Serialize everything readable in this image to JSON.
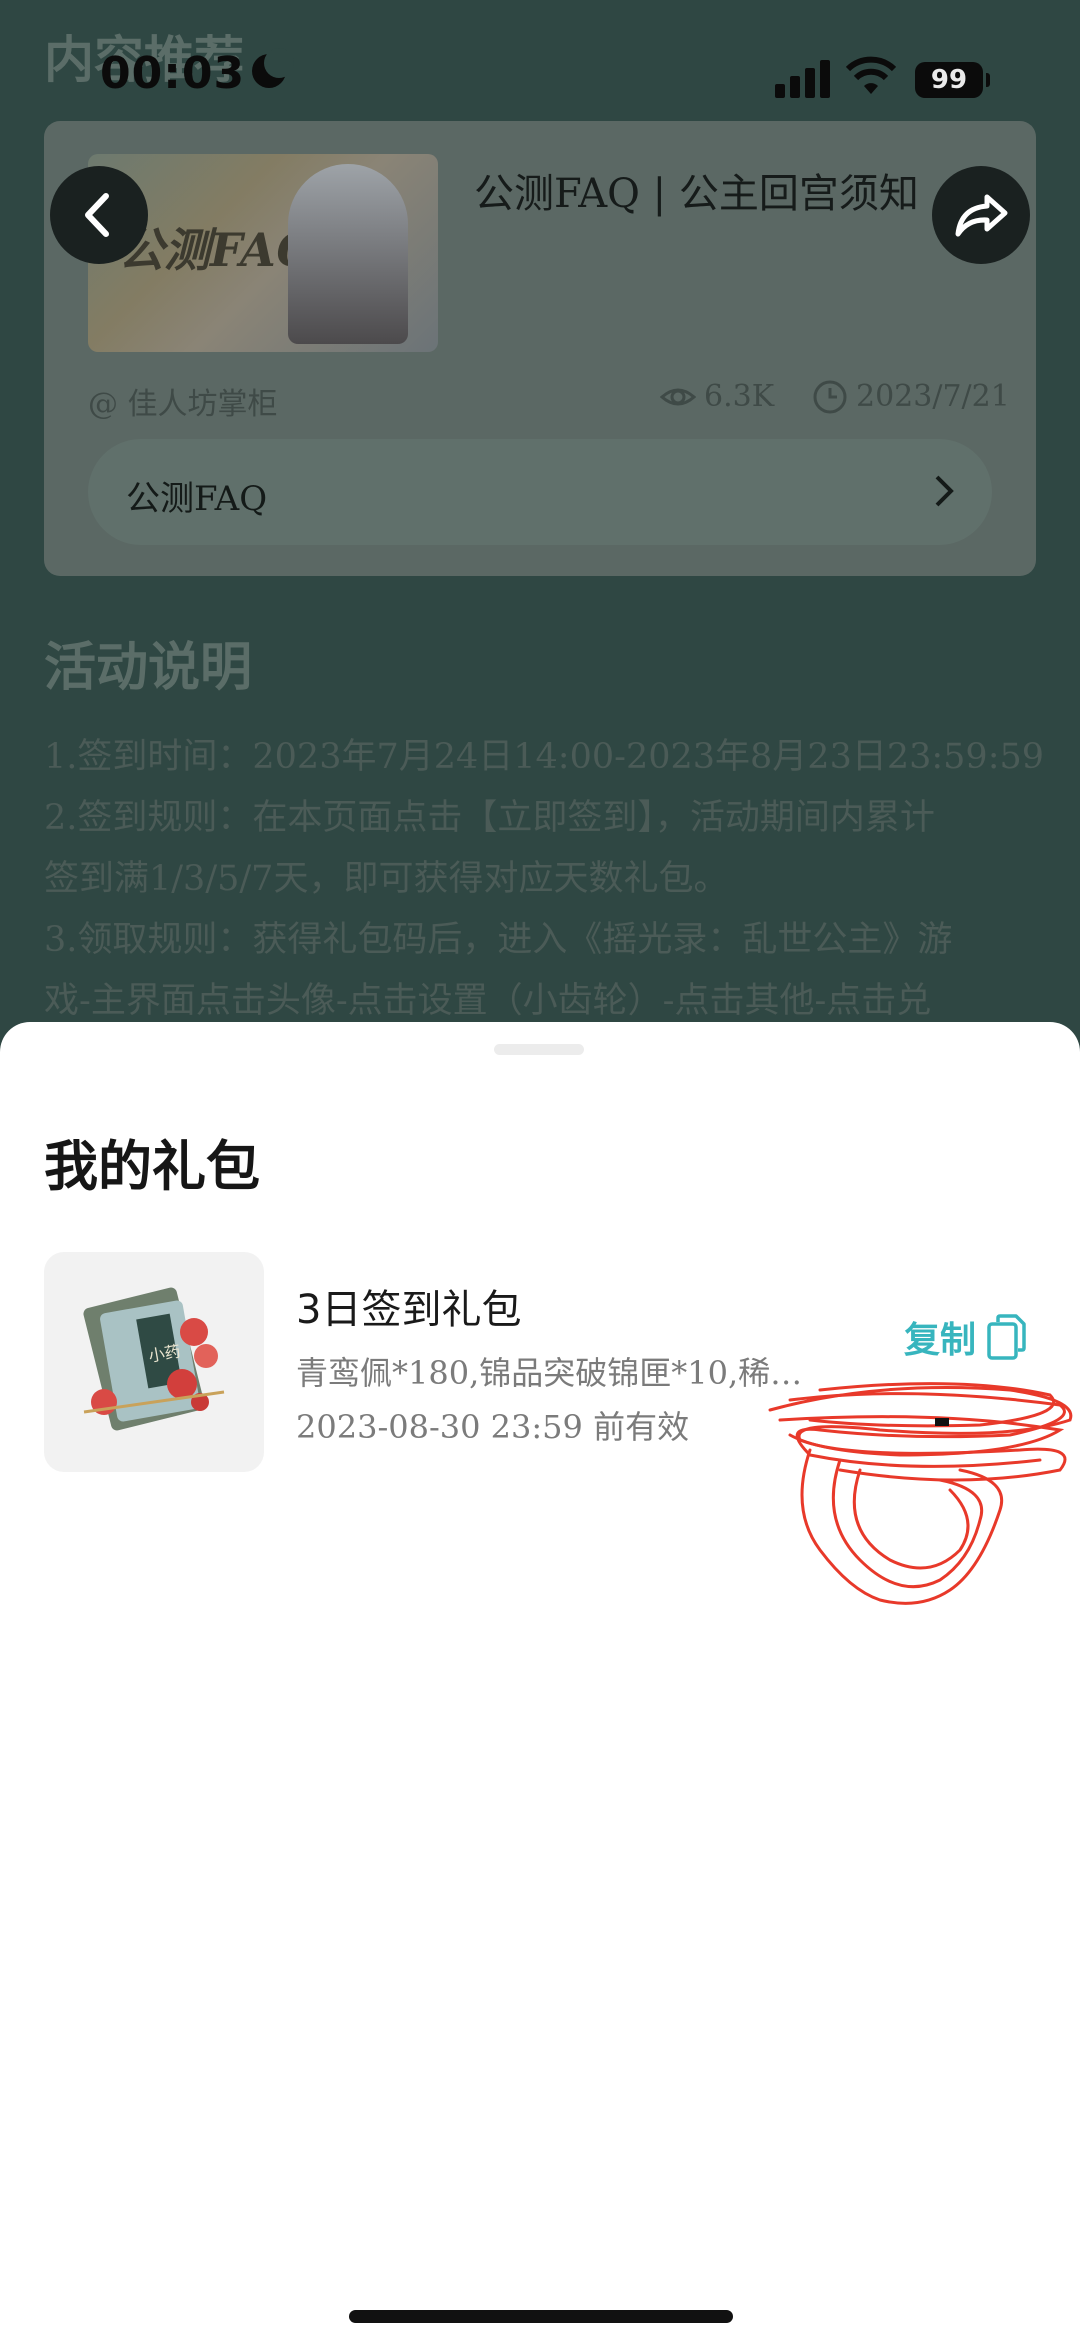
{
  "status_bar": {
    "time": "00:03",
    "battery": "99"
  },
  "background": {
    "section_title": "内容推荐",
    "card": {
      "title": "公测FAQ | 公主回宫须知",
      "thumbnail_label": "公测FAQ",
      "author": "@ 佳人坊掌柜",
      "views": "6.3K",
      "date": "2023/7/21",
      "link_label": "公测FAQ"
    },
    "description": {
      "title": "活动说明",
      "lines": [
        "1.签到时间：2023年7月24日14:00-2023年8月23日23:59:59",
        "2.签到规则：在本页面点击【立即签到】，活动期间内累计",
        "签到满1/3/5/7天，即可获得对应天数礼包。",
        "3.领取规则：获得礼包码后，进入《摇光录：乱世公主》游",
        "戏-主界面点击头像-点击设置（小齿轮）-点击其他-点击兑"
      ]
    }
  },
  "sheet": {
    "title": "我的礼包",
    "gifts": [
      {
        "name": "3日签到礼包",
        "items": "青鸾佩*180,锦品突破锦匣*10,稀…",
        "expiry": "2023-08-30 23:59 前有效",
        "copy_label": "复制",
        "image_label": "小药"
      }
    ]
  },
  "colors": {
    "accent": "#37b5be",
    "scribble": "#e8392a"
  },
  "icons": [
    "back-arrow-icon",
    "share-icon",
    "eye-icon",
    "clock-icon",
    "chevron-right-icon",
    "copy-icon",
    "moon-icon",
    "signal-icon",
    "wifi-icon",
    "battery-icon"
  ]
}
